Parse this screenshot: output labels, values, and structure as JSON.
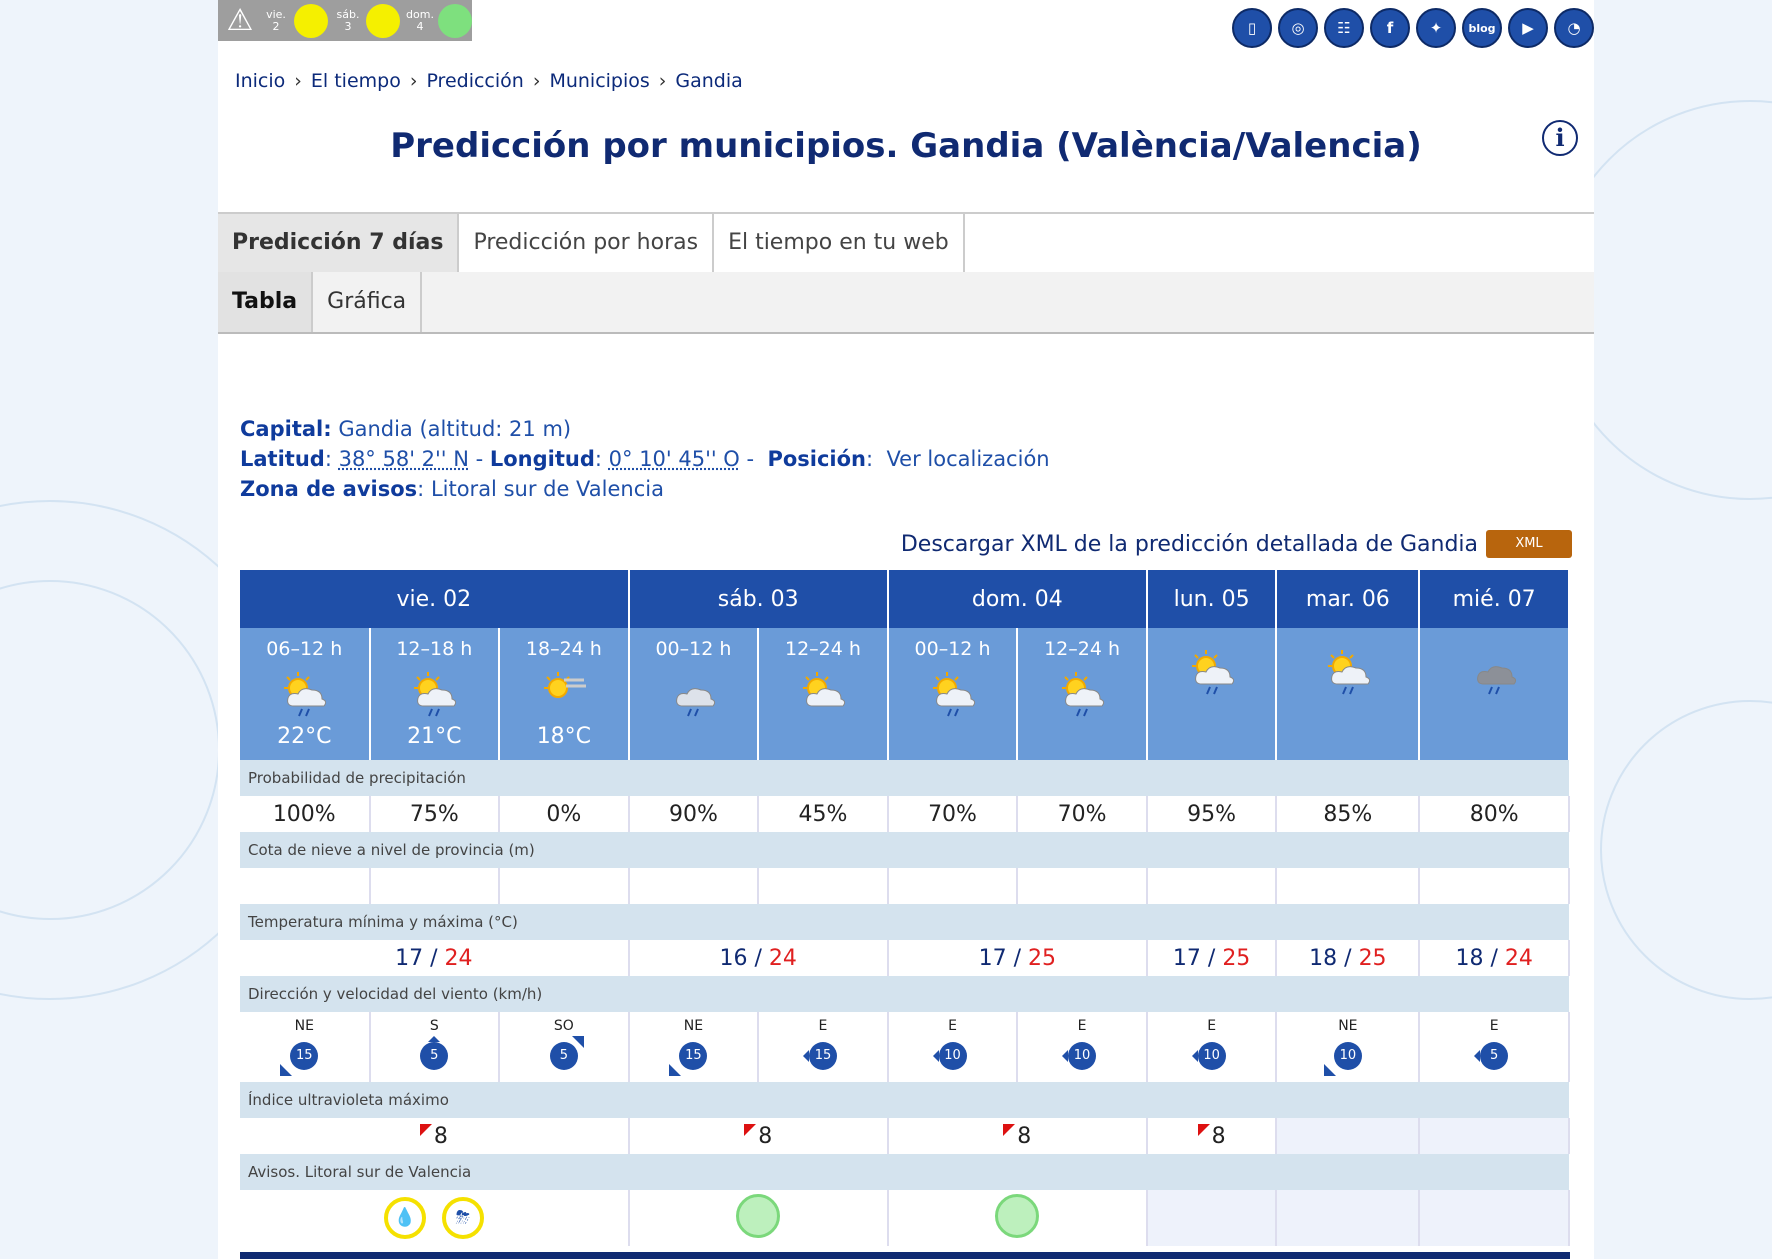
{
  "warnings_strip": {
    "days": [
      {
        "label": "vie.\n2",
        "level_color": "#f5f000"
      },
      {
        "label": "sáb.\n3",
        "level_color": "#f5f000"
      },
      {
        "label": "dom.\n4",
        "level_color": "#7ee07e"
      }
    ]
  },
  "social": [
    "phone-icon",
    "support-icon",
    "sitemap-icon",
    "facebook-icon",
    "twitter-icon",
    "blog-icon",
    "youtube-icon",
    "rss-icon"
  ],
  "breadcrumb": [
    "Inicio",
    "El tiempo",
    "Predicción",
    "Municipios",
    "Gandia"
  ],
  "breadcrumb_sep": "›",
  "title": "Predicción por municipios. Gandia (València/Valencia)",
  "tabs": [
    "Predicción 7 días",
    "Predicción por horas",
    "El tiempo en tu web"
  ],
  "subtabs": [
    "Tabla",
    "Gráfica"
  ],
  "meta": {
    "capital_label": "Capital:",
    "capital_value": "Gandia (altitud: 21 m)",
    "lat_label": "Latitud",
    "lat_value": "38° 58' 2'' N",
    "lon_label": "Longitud",
    "lon_value": "0° 10' 45'' O",
    "pos_label": "Posición",
    "pos_value": "Ver localización",
    "zone_label": "Zona de avisos",
    "zone_value": "Litoral sur de Valencia"
  },
  "xml": {
    "text": "Descargar XML de la predicción detallada de Gandia",
    "button": "XML"
  },
  "table": {
    "days": [
      "vie. 02",
      "sáb. 03",
      "dom. 04",
      "lun. 05",
      "mar. 06",
      "mié. 07"
    ],
    "periods": [
      {
        "label": "06–12 h",
        "icon": "sun-cloud-rain-icon",
        "temp": "22°C"
      },
      {
        "label": "12–18 h",
        "icon": "sun-cloud-rain-icon",
        "temp": "21°C"
      },
      {
        "label": "18–24 h",
        "icon": "sun-haze-icon",
        "temp": "18°C"
      },
      {
        "label": "00–12 h",
        "icon": "cloud-rain-icon",
        "temp": ""
      },
      {
        "label": "12–24 h",
        "icon": "sun-cloud-icon",
        "temp": ""
      },
      {
        "label": "00–12 h",
        "icon": "sun-cloud-rain-icon",
        "temp": ""
      },
      {
        "label": "12–24 h",
        "icon": "sun-cloud-rain-icon",
        "temp": ""
      },
      {
        "label": "",
        "icon": "sun-cloud-rain-icon",
        "temp": ""
      },
      {
        "label": "",
        "icon": "sun-cloud-rain-icon",
        "temp": ""
      },
      {
        "label": "",
        "icon": "dark-cloud-rain-icon",
        "temp": ""
      }
    ],
    "precip_label": "Probabilidad de precipitación",
    "precip": [
      "100%",
      "75%",
      "0%",
      "90%",
      "45%",
      "70%",
      "70%",
      "95%",
      "85%",
      "80%"
    ],
    "snow_label": "Cota de nieve a nivel de provincia (m)",
    "temp_label": "Temperatura mínima y máxima (°C)",
    "temps": [
      {
        "min": "17",
        "max": "24"
      },
      {
        "min": "16",
        "max": "24"
      },
      {
        "min": "17",
        "max": "25"
      },
      {
        "min": "17",
        "max": "25"
      },
      {
        "min": "18",
        "max": "25"
      },
      {
        "min": "18",
        "max": "24"
      }
    ],
    "temp_sep": " / ",
    "wind_label": "Dirección y velocidad del viento (km/h)",
    "wind": [
      {
        "dir": "NE",
        "speed": "15"
      },
      {
        "dir": "S",
        "speed": "5"
      },
      {
        "dir": "SO",
        "speed": "5"
      },
      {
        "dir": "NE",
        "speed": "15"
      },
      {
        "dir": "E",
        "speed": "15"
      },
      {
        "dir": "E",
        "speed": "10"
      },
      {
        "dir": "E",
        "speed": "10"
      },
      {
        "dir": "E",
        "speed": "10"
      },
      {
        "dir": "NE",
        "speed": "10"
      },
      {
        "dir": "E",
        "speed": "5"
      }
    ],
    "uv_label": "Índice ultravioleta máximo",
    "uv": [
      "8",
      "8",
      "8",
      "8",
      "",
      ""
    ],
    "avisos_label": "Avisos. Litoral sur de Valencia",
    "avisos": [
      {
        "type": "yellow",
        "icons": [
          "rain-icon",
          "storm-icon"
        ]
      },
      {
        "type": "green"
      },
      {
        "type": "green"
      },
      {
        "type": "none"
      },
      {
        "type": "none"
      },
      {
        "type": "none"
      }
    ]
  }
}
